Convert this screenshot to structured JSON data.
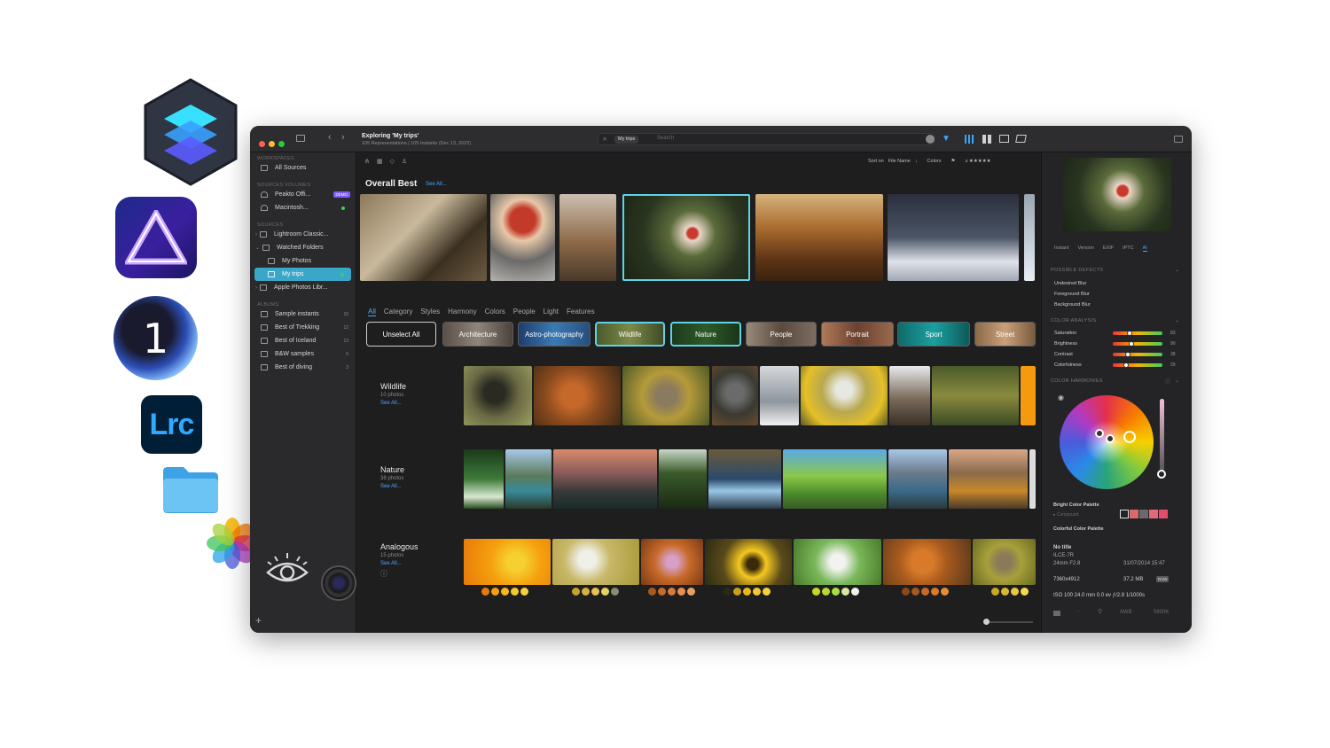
{
  "window": {
    "title": "Exploring 'My trips'",
    "subtitle": "105 Representations | 105 Instants (Dec 13, 2022)"
  },
  "search": {
    "token": "My trips",
    "placeholder": "Search"
  },
  "sidebar": {
    "workspaces_label": "Workspaces",
    "all_sources": "All Sources",
    "volumes_label": "Sources Volumes",
    "volumes": [
      {
        "label": "Peakto Offi...",
        "badge": "DEMO"
      },
      {
        "label": "Macintosh..."
      }
    ],
    "sources_label": "Sources",
    "sources": [
      {
        "label": "Lightroom Classic..."
      },
      {
        "label": "Watched Folders"
      },
      {
        "label": "My Photos"
      },
      {
        "label": "My trips"
      },
      {
        "label": "Apple Photos Libr..."
      }
    ],
    "albums_label": "Albums",
    "albums": [
      {
        "label": "Sample instants",
        "count": "15"
      },
      {
        "label": "Best of Trekking",
        "count": "12"
      },
      {
        "label": "Best of Iceland",
        "count": "13"
      },
      {
        "label": "B&W samples",
        "count": "6"
      },
      {
        "label": "Best of diving",
        "count": "3"
      }
    ],
    "add": "+"
  },
  "toolbar": {
    "sort_on": "Sort on",
    "sort_field": "File Name",
    "colors": "Colors",
    "rating": "≥ ★★★★★"
  },
  "overall": {
    "title": "Overall Best",
    "see_all": "See All..."
  },
  "tabs": [
    "All",
    "Category",
    "Styles",
    "Harmony",
    "Colors",
    "People",
    "Light",
    "Features"
  ],
  "chips": [
    "Unselect All",
    "Architecture",
    "Astro-photography",
    "Wildlife",
    "Nature",
    "People",
    "Portrait",
    "Sport",
    "Street"
  ],
  "rows": [
    {
      "title": "Wildlife",
      "count": "10 photos",
      "see_all": "See All..."
    },
    {
      "title": "Nature",
      "count": "38 photos",
      "see_all": "See All..."
    },
    {
      "title": "Analogous",
      "count": "15 photos",
      "see_all": "See All..."
    }
  ],
  "right_panel": {
    "tabs": [
      "Instant",
      "Version",
      "EXIF",
      "IPTC",
      "AI"
    ],
    "defects_label": "Possible Defects",
    "defects": [
      "Undesired Blur",
      "Foreground Blur",
      "Background Blur"
    ],
    "color_analysis_label": "Color Analysis",
    "color_analysis": [
      {
        "label": "Saturation",
        "value": "83"
      },
      {
        "label": "Brightness",
        "value": "90"
      },
      {
        "label": "Contrast",
        "value": "38"
      },
      {
        "label": "Colorfulness",
        "value": "29"
      }
    ],
    "harmonies_label": "Color Harmonies",
    "palette_label": "Bright Color Palette",
    "palette_sub": "Compound",
    "colorful_label": "Colorful Color Palette",
    "meta": {
      "title": "No title",
      "camera": "ILCE-7R",
      "lens": "24mm F2.8",
      "date": "31/07/2014 15:47",
      "dims": "7360x4912",
      "size": "37.2 MB",
      "format": "RAW",
      "exposure": "ISO 100  24.0 mm  0.0 ev  ƒ/2.8  1/1000s",
      "wb": "AWB",
      "temp": "5800K"
    }
  },
  "colors": {
    "accent": "#3aa7c8",
    "link": "#4aa8ff",
    "window_bg": "#1e1e1f"
  }
}
